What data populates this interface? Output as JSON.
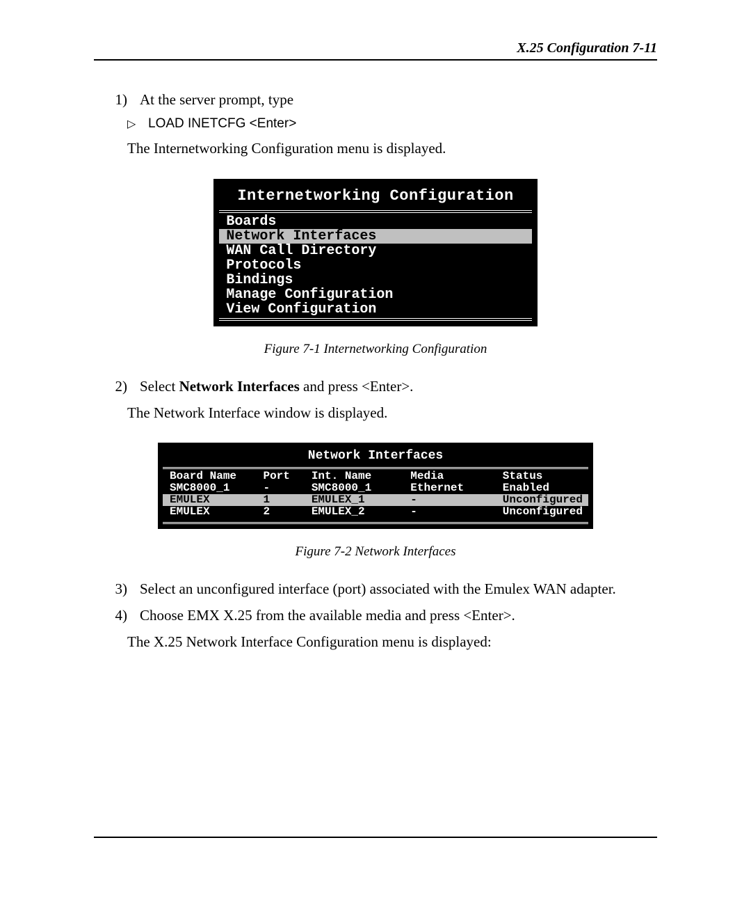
{
  "header": {
    "title": "X.25 Configuration   7-11"
  },
  "steps": {
    "s1": {
      "num": "1)",
      "text": "At the server prompt, type"
    },
    "s1cmd": {
      "marker": "▷",
      "text": "LOAD INETCFG <Enter>"
    },
    "s1follow": "The Internetworking Configuration menu is displayed.",
    "s2": {
      "num": "2)",
      "pre": "Select ",
      "bold": "Network Interfaces",
      "post": " and press <Enter>."
    },
    "s2follow": "The Network Interface window is displayed.",
    "s3": {
      "num": "3)",
      "text": "Select an unconfigured interface (port) associated with the Emulex WAN adapter."
    },
    "s4": {
      "num": "4)",
      "text": "Choose EMX X.25 from the available media and press <Enter>."
    },
    "s4follow": "The X.25 Network Interface Configuration menu is displayed:"
  },
  "fig1": {
    "title": "Internetworking Configuration",
    "items": [
      "Boards",
      "Network Interfaces",
      "WAN Call Directory",
      "Protocols",
      "Bindings",
      "Manage Configuration",
      "View Configuration"
    ],
    "selected": 1,
    "caption": "Figure 7-1 Internetworking Configuration"
  },
  "fig2": {
    "title": "Network Interfaces",
    "headers": {
      "c1": "Board Name",
      "c2": "Port",
      "c3": "Int. Name",
      "c4": "Media",
      "c5": "Status"
    },
    "rows": [
      {
        "c1": "SMC8000_1",
        "c2": "-",
        "c3": "SMC8000_1",
        "c4": "Ethernet",
        "c5": "Enabled"
      },
      {
        "c1": "EMULEX",
        "c2": "1",
        "c3": "EMULEX_1",
        "c4": "-",
        "c5": "Unconfigured"
      },
      {
        "c1": "EMULEX",
        "c2": "2",
        "c3": "EMULEX_2",
        "c4": "-",
        "c5": "Unconfigured"
      }
    ],
    "selected": 1,
    "caption": "Figure 7-2 Network Interfaces"
  }
}
